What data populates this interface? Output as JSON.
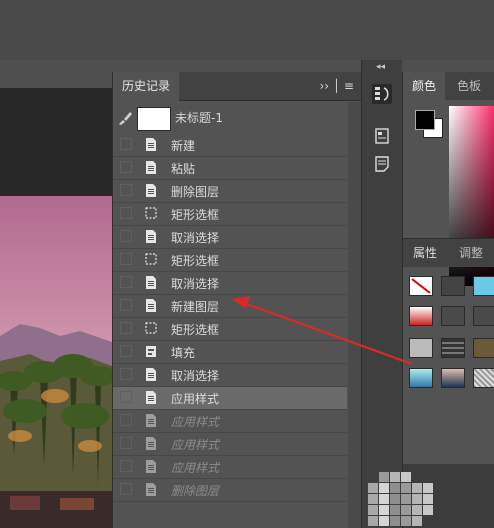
{
  "history_panel": {
    "tab_label": "历史记录",
    "menu_glyphs": "›› │ ≡",
    "snapshot_label": "未标题-1",
    "steps": [
      {
        "label": "新建",
        "icon": "doc-icon",
        "state": "done"
      },
      {
        "label": "粘贴",
        "icon": "doc-icon",
        "state": "done"
      },
      {
        "label": "删除图层",
        "icon": "doc-icon",
        "state": "done"
      },
      {
        "label": "矩形选框",
        "icon": "marquee-icon",
        "state": "done"
      },
      {
        "label": "取消选择",
        "icon": "doc-icon",
        "state": "done"
      },
      {
        "label": "矩形选框",
        "icon": "marquee-icon",
        "state": "done"
      },
      {
        "label": "取消选择",
        "icon": "doc-icon",
        "state": "done"
      },
      {
        "label": "新建图层",
        "icon": "doc-icon",
        "state": "done"
      },
      {
        "label": "矩形选框",
        "icon": "marquee-icon",
        "state": "done"
      },
      {
        "label": "填充",
        "icon": "fill-icon",
        "state": "done"
      },
      {
        "label": "取消选择",
        "icon": "doc-icon",
        "state": "done"
      },
      {
        "label": "应用样式",
        "icon": "doc-icon",
        "state": "current"
      },
      {
        "label": "应用样式",
        "icon": "doc-icon",
        "state": "undone"
      },
      {
        "label": "应用样式",
        "icon": "doc-icon",
        "state": "undone"
      },
      {
        "label": "应用样式",
        "icon": "doc-icon",
        "state": "undone"
      },
      {
        "label": "删除图层",
        "icon": "doc-icon",
        "state": "undone"
      }
    ]
  },
  "color_panel": {
    "tab_color": "颜色",
    "tab_swatches": "色板",
    "foreground": "#000000",
    "background": "#ffffff"
  },
  "properties_panel": {
    "tab_properties": "属性",
    "tab_adjustments": "调整"
  },
  "colors": {
    "panel_bg": "#535353",
    "tab_bar": "#424242",
    "current_row": "#6a6a6a",
    "annotation_arrow": "#d92a2a"
  }
}
